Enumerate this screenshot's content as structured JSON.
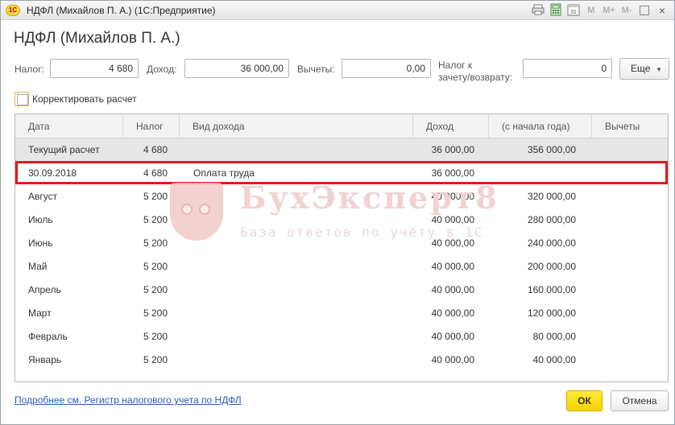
{
  "window": {
    "logo_text": "1С",
    "title": "НДФЛ (Михайлов П. А.)  (1С:Предприятие)",
    "icons": [
      "print-icon",
      "calculator-icon",
      "calendar-icon",
      "memory-icon",
      "memory-plus-icon",
      "memory-minus-icon",
      "restore-icon",
      "close-icon"
    ],
    "m_label": "M",
    "m_plus_label": "M+",
    "m_minus_label": "M-",
    "close_glyph": "×"
  },
  "form": {
    "title": "НДФЛ (Михайлов П. А.)"
  },
  "fields": {
    "tax_label": "Налог:",
    "tax_value": "4 680",
    "income_label": "Доход:",
    "income_value": "36 000,00",
    "deductions_label": "Вычеты:",
    "deductions_value": "0,00",
    "offset_label_1": "Налог к",
    "offset_label_2": "зачету/возврату:",
    "offset_value": "0",
    "more_label": "Еще"
  },
  "correct_checkbox": {
    "label": "Корректировать расчет",
    "checked": false
  },
  "grid": {
    "columns": [
      "Дата",
      "Налог",
      "Вид дохода",
      "Доход",
      "(с начала года)",
      "Вычеты"
    ],
    "rows": [
      {
        "date": "Текущий расчет",
        "tax": "4 680",
        "type": "",
        "income": "36 000,00",
        "ytd": "356 000,00",
        "ded": ""
      },
      {
        "date": "30.09.2018",
        "tax": "4 680",
        "type": "Оплата труда",
        "income": "36 000,00",
        "ytd": "",
        "ded": ""
      },
      {
        "date": "Август",
        "tax": "5 200",
        "type": "",
        "income": "40 000,00",
        "ytd": "320 000,00",
        "ded": ""
      },
      {
        "date": "Июль",
        "tax": "5 200",
        "type": "",
        "income": "40 000,00",
        "ytd": "280 000,00",
        "ded": ""
      },
      {
        "date": "Июнь",
        "tax": "5 200",
        "type": "",
        "income": "40 000,00",
        "ytd": "240 000,00",
        "ded": ""
      },
      {
        "date": "Май",
        "tax": "5 200",
        "type": "",
        "income": "40 000,00",
        "ytd": "200 000,00",
        "ded": ""
      },
      {
        "date": "Апрель",
        "tax": "5 200",
        "type": "",
        "income": "40 000,00",
        "ytd": "160 000,00",
        "ded": ""
      },
      {
        "date": "Март",
        "tax": "5 200",
        "type": "",
        "income": "40 000,00",
        "ytd": "120 000,00",
        "ded": ""
      },
      {
        "date": "Февраль",
        "tax": "5 200",
        "type": "",
        "income": "40 000,00",
        "ytd": "80 000,00",
        "ded": ""
      },
      {
        "date": "Январь",
        "tax": "5 200",
        "type": "",
        "income": "40 000,00",
        "ytd": "40 000,00",
        "ded": ""
      }
    ]
  },
  "watermark": {
    "title": "БухЭксперт8",
    "subtitle": "База ответов по учёту в 1С"
  },
  "footer": {
    "link": "Подробнее см. Регистр налогового учета по НДФЛ",
    "ok_label": "ОК",
    "cancel_label": "Отмена"
  },
  "colors": {
    "highlight": "#e5181f",
    "ok_button": "#f4d300",
    "link": "#2a5eaa"
  }
}
